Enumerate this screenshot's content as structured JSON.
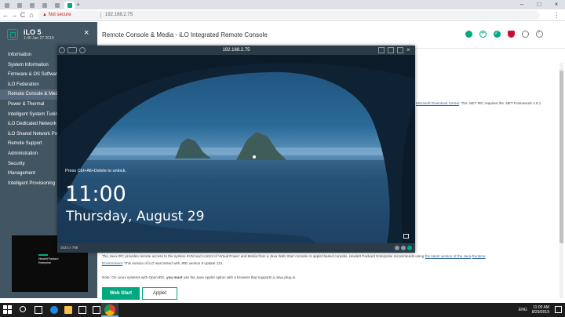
{
  "browser": {
    "url_warning": "Not secure",
    "url": "192.168.2.75",
    "new_tab": "+",
    "tab_close": "×",
    "back": "←",
    "forward": "→",
    "reload": "C",
    "home": "⌂",
    "warn_icon": "▲",
    "menu": "⋮",
    "window_controls": [
      "–",
      "□",
      "×"
    ]
  },
  "sidebar": {
    "title": "iLO 5",
    "version": "1.45 Jan 27 2019",
    "close": "×",
    "items": [
      {
        "label": "Information",
        "active": false
      },
      {
        "label": "System Information",
        "active": false
      },
      {
        "label": "Firmware & OS Software",
        "active": false
      },
      {
        "label": "iLO Federation",
        "active": false
      },
      {
        "label": "Remote Console & Media",
        "active": true
      },
      {
        "label": "Power & Thermal",
        "active": false
      },
      {
        "label": "Intelligent System Tuning",
        "active": false
      },
      {
        "label": "iLO Dedicated Network Port",
        "active": false
      },
      {
        "label": "iLO Shared Network Port",
        "active": false
      },
      {
        "label": "Remote Support",
        "active": false
      },
      {
        "label": "Administration",
        "active": false
      },
      {
        "label": "Security",
        "active": false
      },
      {
        "label": "Management",
        "active": false
      },
      {
        "label": "Intelligent Provisioning",
        "active": false
      }
    ],
    "thumbnail": {
      "line1": "Hewlett Packard",
      "line2": "Enterprise"
    }
  },
  "header": {
    "title": "Remote Console & Media - iLO Integrated Remote Console",
    "icons": [
      "status-icon",
      "add-icon",
      "health-icon",
      "security-shield-icon",
      "user-icon",
      "help-icon"
    ]
  },
  "content": {
    "snippet_right_link": "Microsoft Download Center",
    "snippet_right_text": ". The .NET IRC requires the .NET Framework 4.5.1",
    "java_para_1": "The Java IRC provides remote access to the system KVM and control of Virtual Power and Media from a Java Web Start console or applet based console. Hewlett Packard Enterprise recommends using ",
    "java_link": "the latest version of the Java",
    "java_link_2": "Runtime",
    "java_para_2_link": "Environment",
    "java_para_2": ". This version of iLO was tested with JRE version 8 update 121.",
    "note": "Note: On Linux systems with OpenJDK, ",
    "note_bold": "you must",
    "note_end": " use the Java Applet option with a browser that supports a Java plug-in.",
    "btn_webstart": "Web Start",
    "btn_applet": "Applet"
  },
  "remote_console": {
    "ip": "192.168.2.75",
    "ctrl_alt_del": "Press Ctrl+Alt+Delete to unlock.",
    "time": "11:00",
    "date": "Thursday, August 29",
    "resolution": "1024 x 768",
    "close": "×"
  },
  "taskbar": {
    "lang": "ENG",
    "time": "11:00 AM",
    "date": "8/29/2019"
  }
}
